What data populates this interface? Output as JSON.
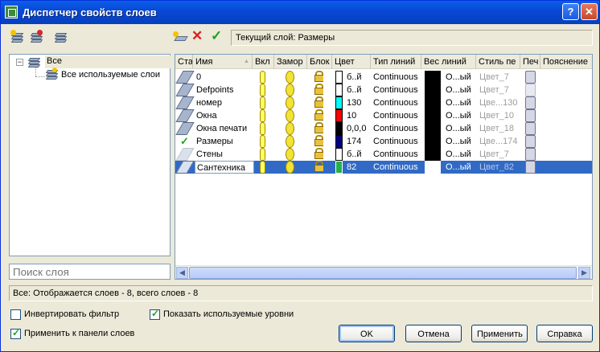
{
  "window": {
    "title": "Диспетчер свойств слоев",
    "help_label": "?",
    "close_label": "✕"
  },
  "toolbar": {
    "current_layer_label": "Текущий слой: Размеры"
  },
  "tree": {
    "root_label": "Все",
    "child_label": "Все используемые слои"
  },
  "search": {
    "placeholder": "Поиск слоя"
  },
  "table": {
    "columns": [
      "Ста",
      "Имя",
      "Вкл",
      "Замор",
      "Блок",
      "Цвет",
      "Тип линий",
      "Вес линий",
      "Стиль пе",
      "Печ",
      "Пояснение"
    ],
    "sort_indicator": "▲",
    "rows": [
      {
        "name": "0",
        "color_swatch": "#ffffff",
        "color": "б..й",
        "linetype": "Continuous",
        "lineweight": "О...ый",
        "plotstyle": "Цвет_7"
      },
      {
        "name": "Defpoints",
        "color_swatch": "#ffffff",
        "color": "б..й",
        "linetype": "Continuous",
        "lineweight": "О...ый",
        "plotstyle": "Цвет_7"
      },
      {
        "name": "номер",
        "color_swatch": "#00ffff",
        "color": "130",
        "linetype": "Continuous",
        "lineweight": "О...ый",
        "plotstyle": "Цве...130"
      },
      {
        "name": "Окна",
        "color_swatch": "#ff0000",
        "color": "10",
        "linetype": "Continuous",
        "lineweight": "О...ый",
        "plotstyle": "Цвет_10"
      },
      {
        "name": "Окна печати",
        "color_swatch": "#000000",
        "color": "0,0,0",
        "linetype": "Continuous",
        "lineweight": "О...ый",
        "plotstyle": "Цвет_18"
      },
      {
        "name": "Размеры",
        "color_swatch": "#000080",
        "color": "174",
        "linetype": "Continuous",
        "lineweight": "О...ый",
        "plotstyle": "Цве...174"
      },
      {
        "name": "Стены",
        "color_swatch": "#ffffff",
        "color": "б..й",
        "linetype": "Continuous",
        "lineweight": "О...ый",
        "plotstyle": "Цвет_7"
      },
      {
        "name": "Сантехника",
        "color_swatch": "#22b14c",
        "color": "82",
        "linetype": "Continuous",
        "lineweight": "О...ый",
        "plotstyle": "Цвет_82"
      }
    ]
  },
  "status": {
    "text": "Все: Отображается слоев - 8, всего слоев - 8"
  },
  "options": {
    "invert_filter": "Инвертировать фильтр",
    "show_used": "Показать используемые уровни",
    "apply_to_toolbar": "Применить к панели слоев"
  },
  "buttons": {
    "ok": "OK",
    "cancel": "Отмена",
    "apply": "Применить",
    "help": "Справка"
  },
  "colors": {
    "title_bar": "#0a5fe8",
    "selection": "#316ac5",
    "dialog_bg": "#ece9d8"
  }
}
